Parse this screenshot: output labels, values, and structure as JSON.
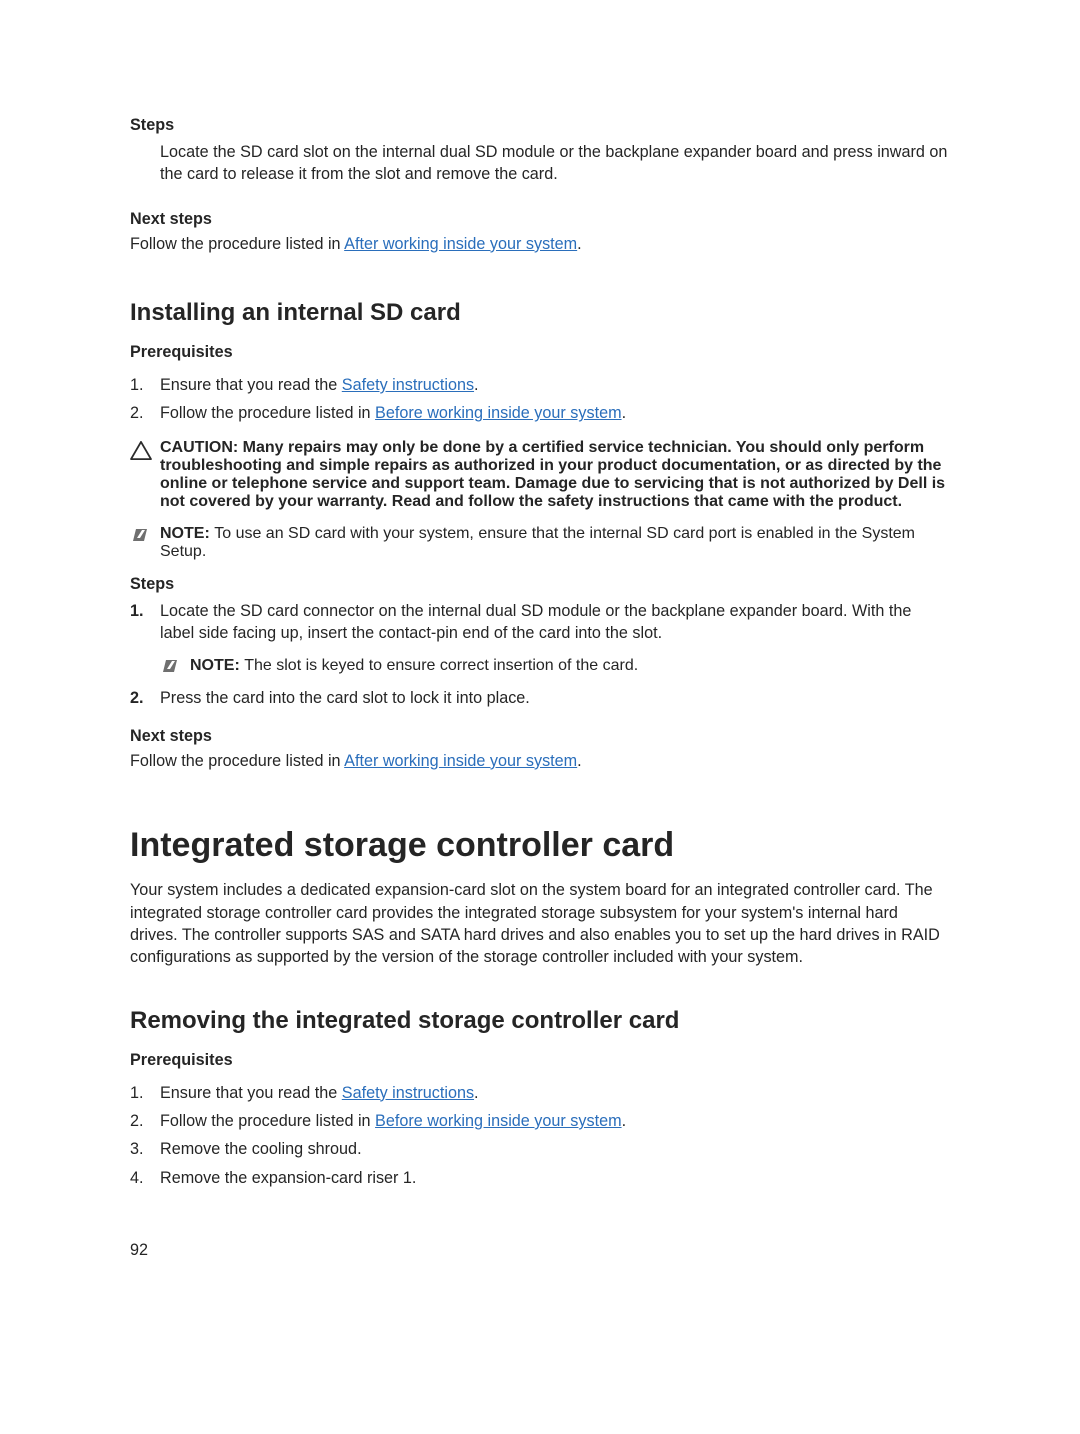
{
  "top": {
    "steps_heading": "Steps",
    "steps_body": "Locate the SD card slot on the internal dual SD module or the backplane expander board and press inward on the card to release it from the slot and remove the card.",
    "next_heading": "Next steps",
    "next_pre": "Follow the procedure listed in ",
    "next_link": "After working inside your system",
    "next_post": "."
  },
  "install": {
    "title": "Installing an internal SD card",
    "prereq_heading": "Prerequisites",
    "items": [
      {
        "n": "1.",
        "pre": "Ensure that you read the ",
        "link": "Safety instructions",
        "post": "."
      },
      {
        "n": "2.",
        "pre": "Follow the procedure listed in ",
        "link": "Before working inside your system",
        "post": "."
      }
    ],
    "caution_label": "CAUTION: ",
    "caution_text": "Many repairs may only be done by a certified service technician. You should only perform troubleshooting and simple repairs as authorized in your product documentation, or as directed by the online or telephone service and support team. Damage due to servicing that is not authorized by Dell is not covered by your warranty. Read and follow the safety instructions that came with the product.",
    "note1_label": "NOTE: ",
    "note1_text": "To use an SD card with your system, ensure that the internal SD card port is enabled in the System Setup.",
    "steps_heading": "Steps",
    "steps": [
      {
        "n": "1.",
        "text": "Locate the SD card connector on the internal dual SD module or the backplane expander board. With the label side facing up, insert the contact-pin end of the card into the slot."
      },
      {
        "n": "2.",
        "text": "Press the card into the card slot to lock it into place."
      }
    ],
    "step1_note_label": "NOTE: ",
    "step1_note_text": "The slot is keyed to ensure correct insertion of the card.",
    "next_heading": "Next steps",
    "next_pre": "Follow the procedure listed in ",
    "next_link": "After working inside your system",
    "next_post": "."
  },
  "isc": {
    "title": "Integrated storage controller card",
    "para": "Your system includes a dedicated expansion-card slot on the system board for an integrated controller card. The integrated storage controller card provides the integrated storage subsystem for your system's internal hard drives. The controller supports SAS and SATA hard drives and also enables you to set up the hard drives in RAID configurations as supported by the version of the storage controller included with your system.",
    "sub_title": "Removing the integrated storage controller card",
    "prereq_heading": "Prerequisites",
    "items": [
      {
        "n": "1.",
        "pre": "Ensure that you read the ",
        "link": "Safety instructions",
        "post": "."
      },
      {
        "n": "2.",
        "pre": "Follow the procedure listed in ",
        "link": "Before working inside your system",
        "post": "."
      },
      {
        "n": "3.",
        "pre": "Remove the cooling shroud.",
        "link": "",
        "post": ""
      },
      {
        "n": "4.",
        "pre": "Remove the expansion-card riser 1.",
        "link": "",
        "post": ""
      }
    ]
  },
  "page_number": "92"
}
